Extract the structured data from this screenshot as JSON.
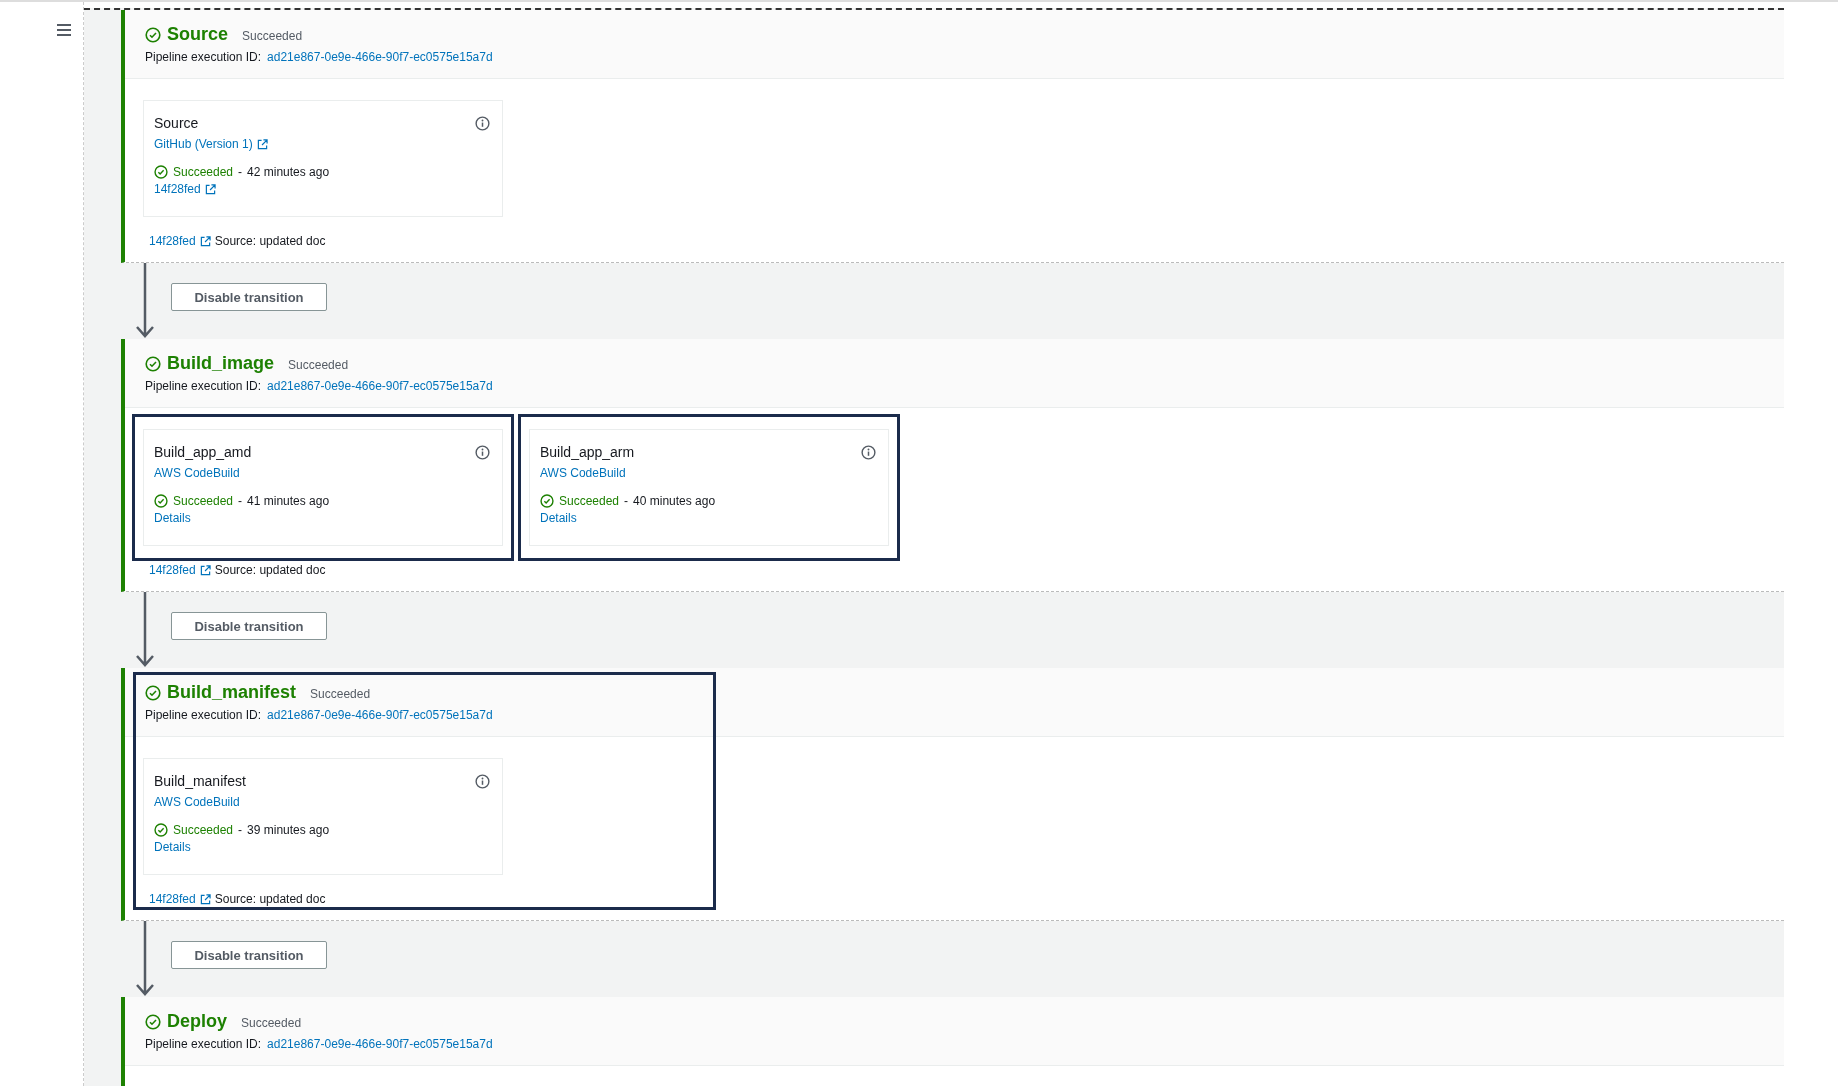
{
  "stages": [
    {
      "name": "Source",
      "status": "Succeeded",
      "execution_label": "Pipeline execution ID:",
      "execution_id": "ad21e867-0e9e-466e-90f7-ec0575e15a7d",
      "actions": [
        {
          "name": "Source",
          "provider": "GitHub (Version 1)",
          "provider_external": true,
          "status": "Succeeded",
          "separator": "-",
          "time": "42 minutes ago",
          "link": "14f28fed",
          "link_external": true,
          "highlighted": false
        }
      ],
      "commit": {
        "id": "14f28fed",
        "message": "Source: updated doc"
      },
      "transition": "Disable transition"
    },
    {
      "name": "Build_image",
      "status": "Succeeded",
      "execution_label": "Pipeline execution ID:",
      "execution_id": "ad21e867-0e9e-466e-90f7-ec0575e15a7d",
      "actions": [
        {
          "name": "Build_app_amd",
          "provider": "AWS CodeBuild",
          "status": "Succeeded",
          "separator": "-",
          "time": "41 minutes ago",
          "link": "Details",
          "highlighted": true
        },
        {
          "name": "Build_app_arm",
          "provider": "AWS CodeBuild",
          "status": "Succeeded",
          "separator": "-",
          "time": "40 minutes ago",
          "link": "Details",
          "highlighted": true
        }
      ],
      "commit": {
        "id": "14f28fed",
        "message": "Source: updated doc"
      },
      "transition": "Disable transition"
    },
    {
      "name": "Build_manifest",
      "status": "Succeeded",
      "execution_label": "Pipeline execution ID:",
      "execution_id": "ad21e867-0e9e-466e-90f7-ec0575e15a7d",
      "highlighted": true,
      "actions": [
        {
          "name": "Build_manifest",
          "provider": "AWS CodeBuild",
          "status": "Succeeded",
          "separator": "-",
          "time": "39 minutes ago",
          "link": "Details",
          "highlighted": false
        }
      ],
      "commit": {
        "id": "14f28fed",
        "message": "Source: updated doc"
      },
      "transition": "Disable transition"
    },
    {
      "name": "Deploy",
      "status": "Succeeded",
      "execution_label": "Pipeline execution ID:",
      "execution_id": "ad21e867-0e9e-466e-90f7-ec0575e15a7d"
    }
  ]
}
